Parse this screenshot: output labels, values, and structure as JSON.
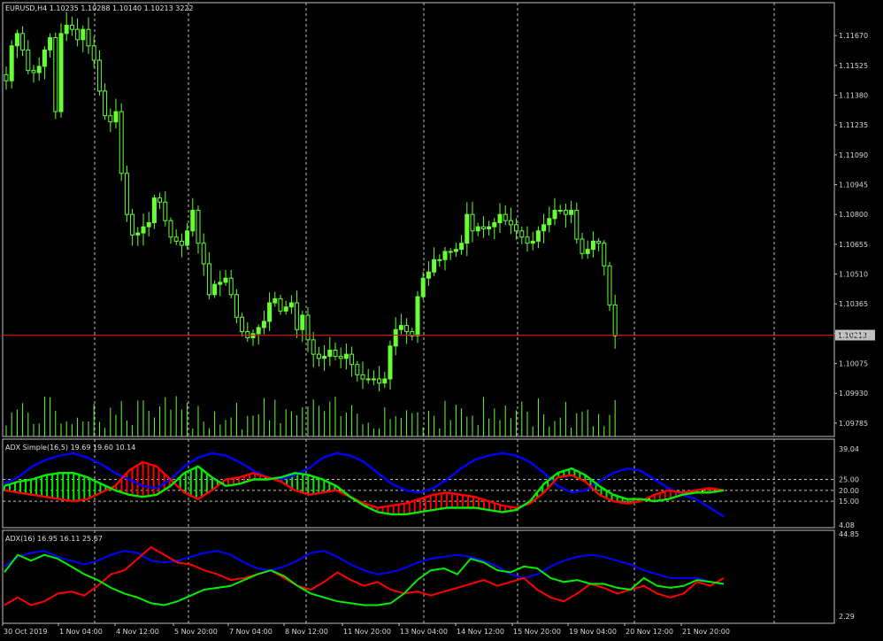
{
  "colors": {
    "background": "#000000",
    "frame": "#c0c0c0",
    "grid": "#bfbfbf",
    "bull": "#66ff33",
    "bear_fill": "#000000",
    "price_line": "#ff0000",
    "volume": "#66ff33",
    "adx_line": "#0000ff",
    "plus_di": "#ff0000",
    "minus_di": "#00ee00",
    "hist_green": "#00ee00",
    "hist_red": "#ff0000",
    "hist_yellow": "#ffff00",
    "text": "#d8d8d8",
    "price_box": "#c0c0c0"
  },
  "main_panel": {
    "title": "EURUSD,H4  1.10235 1.10288 1.10140 1.10213  3222",
    "current_price": 1.10213,
    "current_price_label": "1.10213",
    "y_ticks": [
      "1.11670",
      "1.11525",
      "1.11380",
      "1.11235",
      "1.11090",
      "1.10945",
      "1.10800",
      "1.10655",
      "1.10510",
      "1.10365",
      "1.10220",
      "1.10075",
      "1.09930",
      "1.09785"
    ]
  },
  "adx_simple_panel": {
    "title": "ADX Simple(16,5) 19.69 19.60 10.14",
    "y_ticks": [
      "39.04",
      "25.00",
      "20.00",
      "15.00",
      "4.08"
    ]
  },
  "adx_panel": {
    "title": "ADX(16) 16.95 16.11 25.67",
    "y_ticks": [
      "44.85",
      "2.29"
    ]
  },
  "x_labels": [
    "30 Oct 2019",
    "1 Nov 04:00",
    "4 Nov 12:00",
    "5 Nov 20:00",
    "7 Nov 04:00",
    "8 Nov 12:00",
    "11 Nov 20:00",
    "13 Nov 04:00",
    "14 Nov 12:00",
    "15 Nov 20:00",
    "19 Nov 04:00",
    "20 Nov 12:00",
    "21 Nov 20:00"
  ],
  "chart_data": [
    {
      "type": "candlestick",
      "symbol": "EURUSD",
      "timeframe": "H4",
      "y_ticks": [
        1.1167,
        1.11525,
        1.1138,
        1.11235,
        1.1109,
        1.10945,
        1.108,
        1.10655,
        1.1051,
        1.10365,
        1.1022,
        1.10075,
        1.0993,
        1.09785
      ],
      "ylim": [
        1.0972,
        1.1183
      ],
      "ohlc_close": [
        1.1145,
        1.1162,
        1.1168,
        1.116,
        1.115,
        1.1149,
        1.1152,
        1.116,
        1.1166,
        1.113,
        1.1168,
        1.1172,
        1.117,
        1.1165,
        1.117,
        1.1162,
        1.1155,
        1.114,
        1.1128,
        1.1125,
        1.113,
        1.11,
        1.108,
        1.107,
        1.1071,
        1.1074,
        1.1076,
        1.1088,
        1.1086,
        1.1077,
        1.1069,
        1.1067,
        1.1065,
        1.1072,
        1.1082,
        1.1066,
        1.1056,
        1.1041,
        1.1046,
        1.1047,
        1.1049,
        1.1041,
        1.103,
        1.1023,
        1.102,
        1.1022,
        1.1025,
        1.1028,
        1.1037,
        1.1039,
        1.1033,
        1.1035,
        1.1037,
        1.1024,
        1.1031,
        1.1019,
        1.1012,
        1.101,
        1.1011,
        1.1014,
        1.1011,
        1.101,
        1.1012,
        1.1007,
        1.1002,
        1.1,
        1.1,
        1.1,
        1.0998,
        1.1,
        1.1016,
        1.1024,
        1.1026,
        1.1023,
        1.1021,
        1.104,
        1.1049,
        1.1052,
        1.1058,
        1.1058,
        1.1062,
        1.1062,
        1.1063,
        1.1066,
        1.108,
        1.1072,
        1.1074,
        1.1073,
        1.1074,
        1.1076,
        1.108,
        1.1077,
        1.1075,
        1.1072,
        1.1069,
        1.1066,
        1.1067,
        1.1072,
        1.1075,
        1.1078,
        1.1082,
        1.1082,
        1.108,
        1.1082,
        1.1068,
        1.1061,
        1.1063,
        1.1067,
        1.1066,
        1.1055,
        1.1036,
        1.1021
      ]
    },
    {
      "type": "line",
      "title": "ADX Simple(16,5)",
      "values_shown": [
        19.69,
        19.6,
        10.14
      ],
      "ylim": [
        4.08,
        39.04
      ],
      "reference_levels": [
        25,
        20,
        15
      ],
      "series": [
        {
          "name": "adx",
          "color": "#0000ff",
          "values": [
            23,
            26,
            31,
            34,
            36,
            37,
            35,
            32,
            28,
            25,
            22,
            21,
            25,
            31,
            35,
            37,
            36,
            33,
            29,
            26,
            25,
            27,
            30,
            35,
            37,
            36,
            33,
            28,
            23,
            20,
            19,
            21,
            25,
            30,
            34,
            36,
            37,
            36,
            33,
            28,
            22,
            19,
            20,
            24,
            28,
            30,
            29,
            25,
            21,
            18,
            16,
            12,
            8
          ]
        },
        {
          "name": "plus_di",
          "color": "#ff0000",
          "values": [
            20,
            19,
            18,
            17,
            16,
            15,
            16,
            19,
            22,
            29,
            33,
            31,
            25,
            19,
            16,
            20,
            25,
            26,
            28,
            26,
            24,
            20,
            18,
            19,
            20,
            17,
            14,
            12,
            13,
            14,
            16,
            18,
            19,
            18,
            17,
            15,
            13,
            12,
            14,
            19,
            26,
            27,
            24,
            18,
            15,
            14,
            15,
            18,
            20,
            19,
            20,
            21,
            20
          ]
        },
        {
          "name": "minus_di",
          "color": "#00ee00",
          "values": [
            22,
            24,
            25,
            27,
            28,
            28,
            26,
            23,
            20,
            18,
            17,
            18,
            22,
            28,
            31,
            26,
            22,
            23,
            25,
            25,
            26,
            28,
            27,
            25,
            22,
            17,
            13,
            10,
            9,
            9,
            10,
            11,
            12,
            12,
            12,
            11,
            10,
            11,
            15,
            23,
            28,
            30,
            27,
            22,
            18,
            16,
            16,
            15,
            16,
            18,
            19,
            19,
            20
          ]
        }
      ]
    },
    {
      "type": "line",
      "title": "ADX(16)",
      "values_shown": [
        16.95,
        16.11,
        25.67
      ],
      "ylim": [
        2.29,
        44.85
      ],
      "series": [
        {
          "name": "adx",
          "color": "#0000ff",
          "values": [
            28,
            33,
            35,
            36,
            33,
            31,
            29,
            31,
            34,
            36,
            35,
            31,
            30,
            31,
            33,
            35,
            36,
            34,
            30,
            27,
            26,
            28,
            31,
            35,
            36,
            33,
            29,
            26,
            24,
            25,
            27,
            30,
            32,
            33,
            34,
            33,
            31,
            28,
            24,
            22,
            24,
            28,
            31,
            33,
            34,
            33,
            31,
            29,
            26,
            24,
            22,
            22,
            22,
            20,
            19
          ]
        },
        {
          "name": "plus_di",
          "color": "#ff0000",
          "values": [
            8,
            12,
            8,
            10,
            14,
            15,
            13,
            18,
            24,
            26,
            32,
            38,
            34,
            30,
            29,
            26,
            24,
            21,
            22,
            24,
            26,
            22,
            18,
            16,
            20,
            25,
            21,
            18,
            20,
            16,
            14,
            15,
            13,
            15,
            17,
            19,
            21,
            18,
            20,
            22,
            16,
            12,
            10,
            14,
            19,
            17,
            14,
            16,
            18,
            14,
            12,
            14,
            20,
            18,
            22
          ]
        },
        {
          "name": "minus_di",
          "color": "#00ee00",
          "values": [
            25,
            34,
            31,
            34,
            32,
            28,
            24,
            21,
            17,
            14,
            12,
            9,
            8,
            10,
            13,
            16,
            17,
            18,
            21,
            24,
            26,
            23,
            18,
            14,
            12,
            10,
            9,
            8,
            8,
            9,
            14,
            21,
            26,
            27,
            24,
            32,
            30,
            26,
            25,
            28,
            27,
            22,
            20,
            21,
            19,
            19,
            17,
            16,
            22,
            18,
            17,
            18,
            21,
            20,
            19
          ]
        }
      ]
    }
  ]
}
